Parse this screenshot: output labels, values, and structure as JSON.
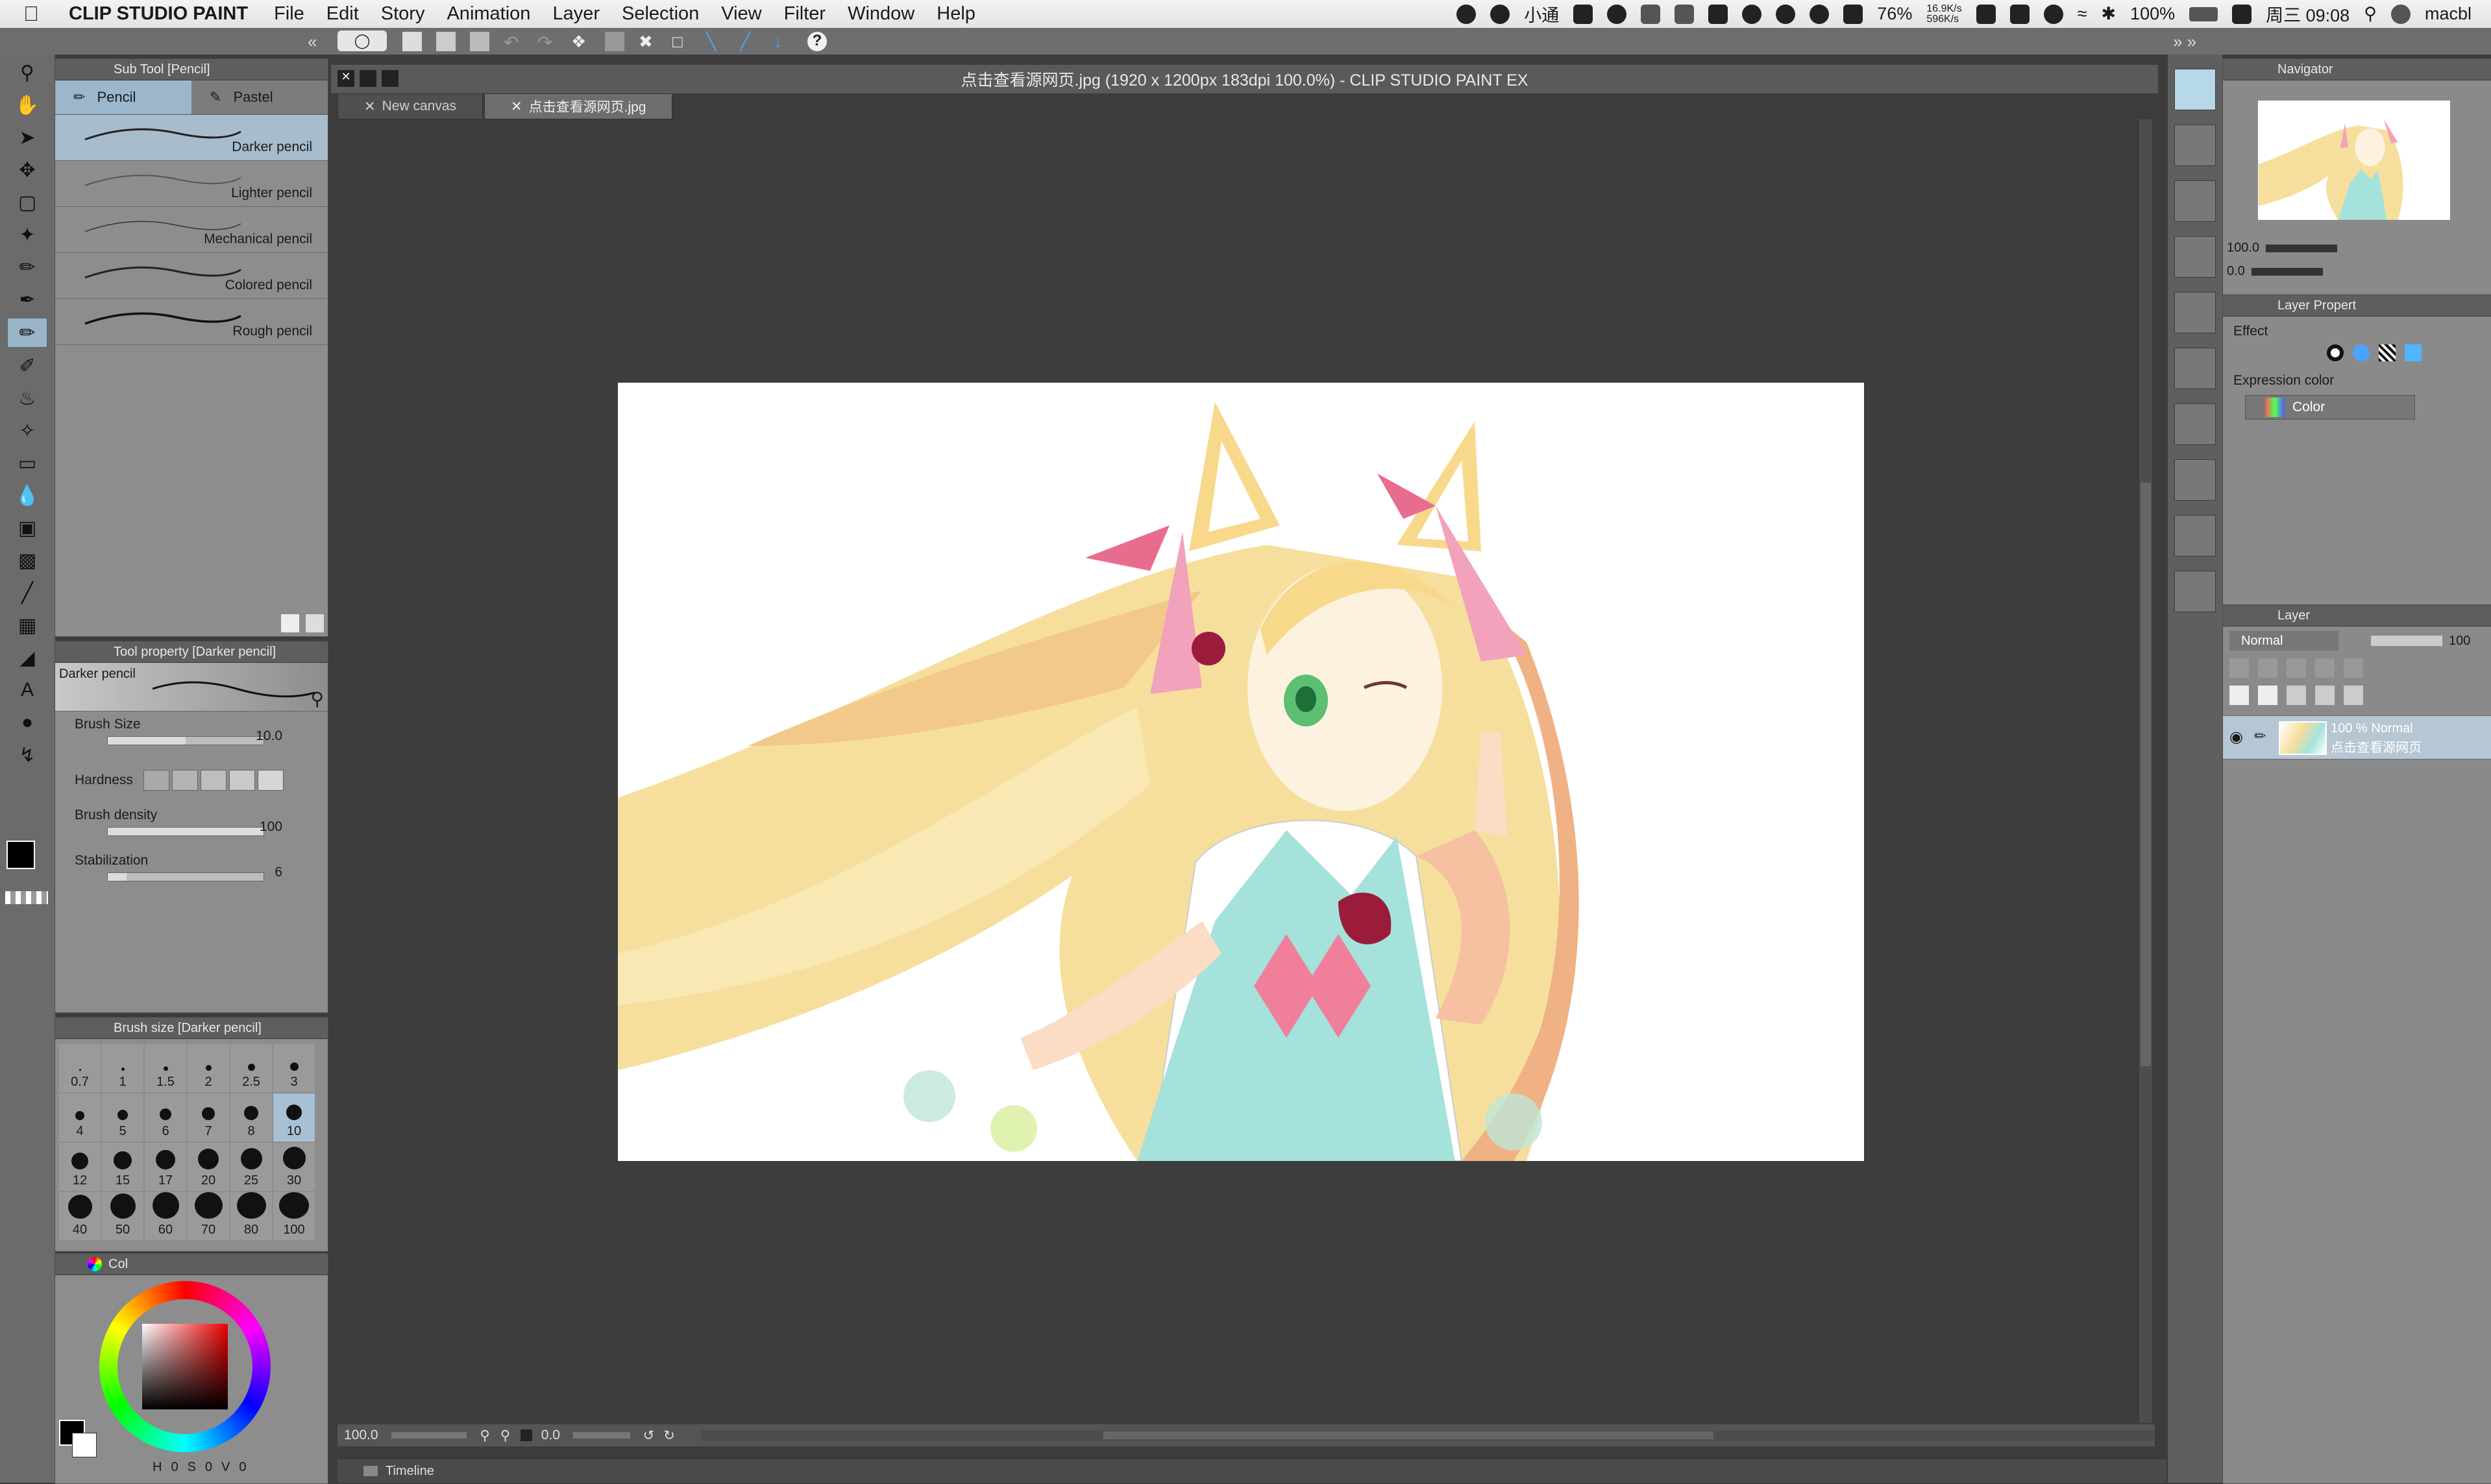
{
  "menubar": {
    "app_name": "CLIP STUDIO PAINT",
    "items": [
      "File",
      "Edit",
      "Story",
      "Animation",
      "Layer",
      "Selection",
      "View",
      "Filter",
      "Window",
      "Help"
    ],
    "tray": {
      "ime": "小通",
      "battery_percent": "76%",
      "net_up": "16.9K/s",
      "net_down": "596K/s",
      "power": "100%",
      "clock": "周三 09:08",
      "user": "macbl"
    }
  },
  "subtool": {
    "title": "Sub Tool [Pencil]",
    "tabs": [
      "Pencil",
      "Pastel"
    ],
    "brushes": [
      "Darker pencil",
      "Lighter pencil",
      "Mechanical pencil",
      "Colored pencil",
      "Rough pencil"
    ]
  },
  "tool_property": {
    "title": "Tool property [Darker pencil]",
    "preview_name": "Darker pencil",
    "rows": [
      {
        "label": "Brush Size",
        "value": "10.0",
        "fill": 0.5
      },
      {
        "label": "Hardness",
        "value": "",
        "fill": 0
      },
      {
        "label": "Brush density",
        "value": "100",
        "fill": 1.0
      },
      {
        "label": "Stabilization",
        "value": "6",
        "fill": 0.12
      }
    ]
  },
  "brush_size": {
    "title": "Brush size [Darker pencil]",
    "sizes": [
      "0.7",
      "1",
      "1.5",
      "2",
      "2.5",
      "3",
      "4",
      "5",
      "6",
      "7",
      "8",
      "10",
      "12",
      "15",
      "17",
      "20",
      "25",
      "30",
      "40",
      "50",
      "60",
      "70",
      "80",
      "100"
    ],
    "selected": "10"
  },
  "color_panel": {
    "title": "Col",
    "readout": [
      "H",
      "0",
      "S",
      "0",
      "V",
      "0"
    ]
  },
  "document": {
    "title": "点击查看源网页.jpg (1920 x 1200px 183dpi 100.0%)  - CLIP STUDIO PAINT EX",
    "tabs": [
      "New canvas",
      "点击查看源网页.jpg"
    ],
    "active_tab": 1
  },
  "status": {
    "zoom": "100.0",
    "rotation": "0.0"
  },
  "timeline": {
    "label": "Timeline"
  },
  "navigator": {
    "title": "Navigator",
    "zoom": "100.0",
    "rotation": "0.0"
  },
  "layer_property": {
    "title": "Layer Propert",
    "effect_label": "Effect",
    "expression_color_label": "Expression color",
    "expression_color_value": "Color"
  },
  "layer_panel": {
    "title": "Layer",
    "blend_mode": "Normal",
    "opacity": "100",
    "layers": [
      {
        "line1": "100 % Normal",
        "line2": "点击查看源网页"
      }
    ]
  },
  "colors": {
    "accent": "#9cb6cb",
    "panel": "#8d8d8d",
    "canvas_bg": "#3d3d3d"
  }
}
